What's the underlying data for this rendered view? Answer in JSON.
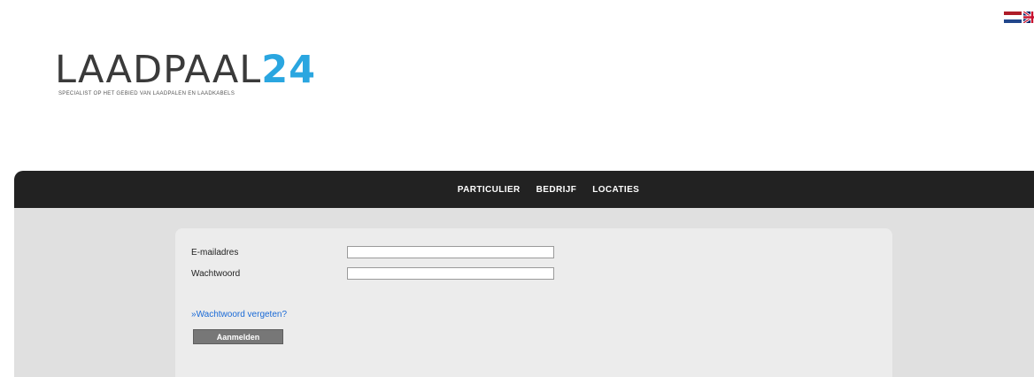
{
  "colors": {
    "accent": "#2aa6e0",
    "navbar": "#222222",
    "content_bg": "#e0e0e0",
    "panel_bg": "#ececec",
    "link": "#1a6ad6",
    "button": "#777777"
  },
  "header": {
    "languages": [
      {
        "icon": "flag-nl-icon"
      },
      {
        "icon": "flag-uk-icon"
      }
    ],
    "logo": {
      "text_main": "LAADPAAL",
      "text_num": "24",
      "tagline": "SPECIALIST OP HET GEBIED VAN LAADPALEN EN LAADKABELS"
    }
  },
  "nav": {
    "items": [
      {
        "label": "PARTICULIER"
      },
      {
        "label": "BEDRIJF"
      },
      {
        "label": "LOCATIES"
      }
    ]
  },
  "login": {
    "email_label": "E-mailadres",
    "email_value": "",
    "password_label": "Wachtwoord",
    "password_value": "",
    "forgot_arrow": "»",
    "forgot_label": "Wachtwoord vergeten?",
    "submit_label": "Aanmelden"
  }
}
